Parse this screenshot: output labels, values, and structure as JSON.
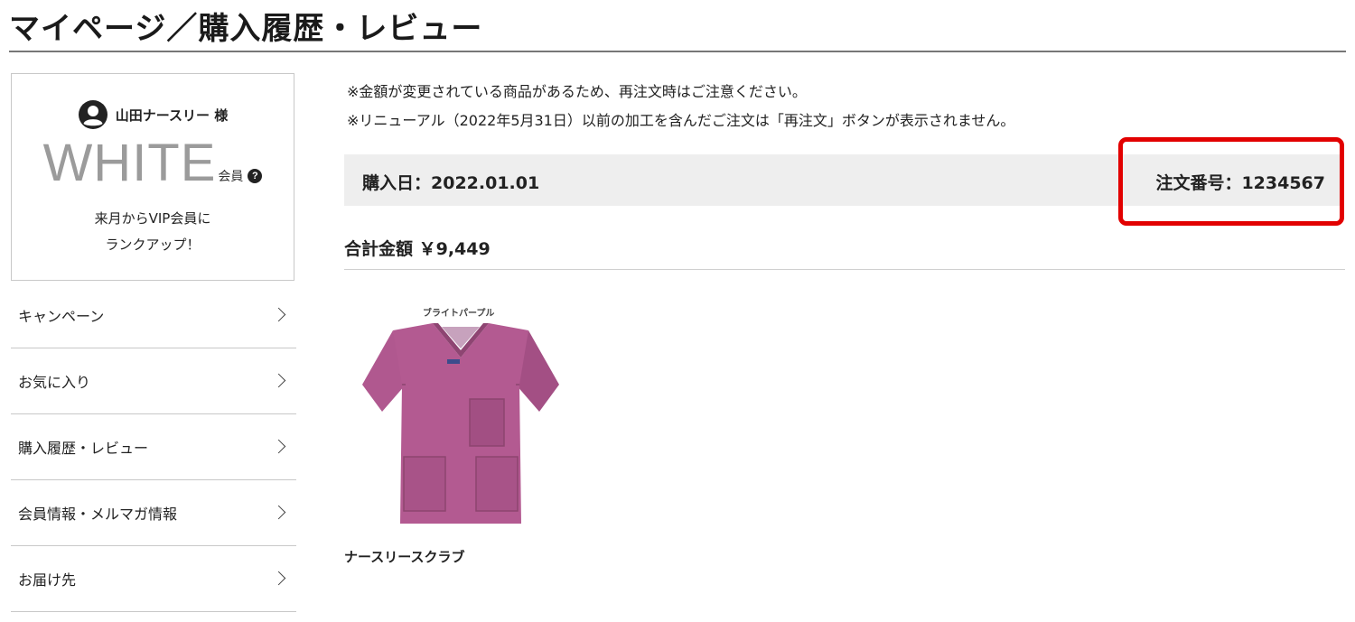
{
  "page": {
    "title": "マイページ／購入履歴・レビュー"
  },
  "member": {
    "name": "山田ナースリー 様",
    "rank": "WHITE",
    "rank_suffix": "会員",
    "help_symbol": "?",
    "rankup_line1": "来月からVIP会員に",
    "rankup_line2": "ランクアップ！"
  },
  "menu": {
    "items": [
      {
        "label": "キャンペーン"
      },
      {
        "label": "お気に入り"
      },
      {
        "label": "購入履歴・レビュー"
      },
      {
        "label": "会員情報・メルマガ情報"
      },
      {
        "label": "お届け先"
      }
    ]
  },
  "notices": [
    "※金額が変更されている商品があるため、再注文時はご注意ください。",
    "※リニューアル（2022年5月31日）以前の加工を含んだご注文は「再注文」ボタンが表示されません。"
  ],
  "order": {
    "purchase_date": "購入日：2022.01.01",
    "order_number": "注文番号：1234567",
    "total": "合計金額 ￥9,449"
  },
  "product": {
    "color_label": "ブライトパープル",
    "name": "ナースリースクラブ"
  },
  "icons": {
    "user": "user-circle-icon",
    "help": "question-circle-icon",
    "chevron": "chevron-right-icon"
  },
  "colors": {
    "highlight": "#e20000",
    "scrub": "#b0588f",
    "rank_text": "#9b9b9b",
    "order_bar": "#eeeeee"
  }
}
